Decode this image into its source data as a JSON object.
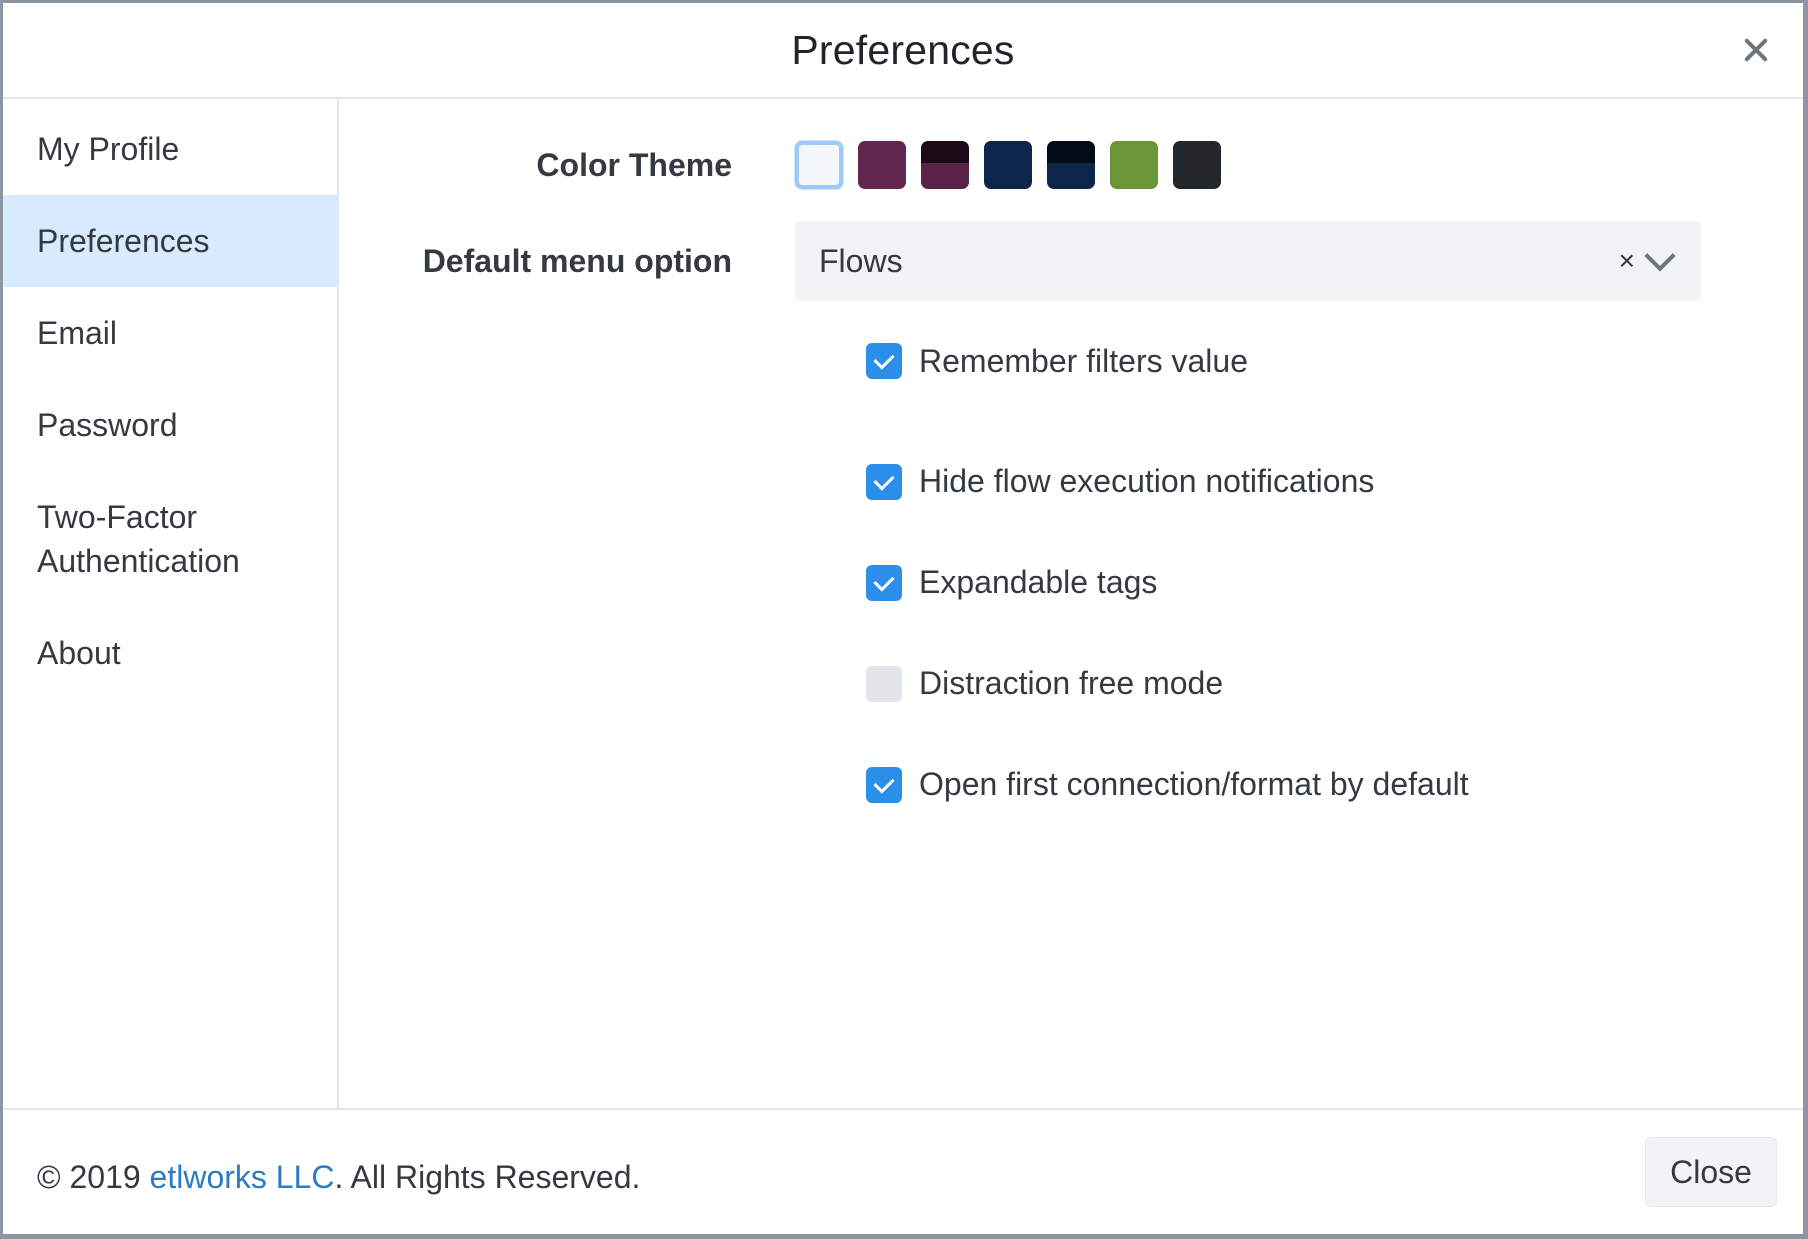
{
  "dialog": {
    "title": "Preferences",
    "close_icon": "close-icon"
  },
  "sidebar": {
    "items": [
      {
        "label": "My Profile",
        "active": false
      },
      {
        "label": "Preferences",
        "active": true
      },
      {
        "label": "Email",
        "active": false
      },
      {
        "label": "Password",
        "active": false
      },
      {
        "label_line1": "Two-Factor",
        "label_line2": "Authentication",
        "active": false
      },
      {
        "label": "About",
        "active": false
      }
    ]
  },
  "form": {
    "color_theme_label": "Color Theme",
    "themes": [
      {
        "top": "#f4f8fd",
        "bottom": "#f4f8fd",
        "selected": true
      },
      {
        "top": "#62264f",
        "bottom": "#62264f",
        "selected": false
      },
      {
        "top": "#1d0a16",
        "bottom": "#5b2249",
        "selected": false
      },
      {
        "top": "#0c2548",
        "bottom": "#0c2548",
        "selected": false
      },
      {
        "top": "#020a17",
        "bottom": "#0c2548",
        "selected": false
      },
      {
        "top": "#6a9538",
        "bottom": "#6a9538",
        "selected": false
      },
      {
        "top": "#25282b",
        "bottom": "#25282b",
        "selected": false
      }
    ],
    "default_menu_label": "Default menu option",
    "default_menu_value": "Flows",
    "clear_symbol": "×",
    "options": [
      {
        "label": "Remember filters value",
        "checked": true
      },
      {
        "label": "Hide flow execution notifications",
        "checked": true
      },
      {
        "label": "Expandable tags",
        "checked": true
      },
      {
        "label": "Distraction free mode",
        "checked": false
      },
      {
        "label": "Open first connection/format by default",
        "checked": true
      }
    ]
  },
  "footer": {
    "copyright_prefix": "© 2019 ",
    "company_link": "etlworks LLC",
    "copyright_suffix": ". All Rights Reserved.",
    "close_button": "Close"
  },
  "colors": {
    "accent": "#2b8ee8",
    "active_nav": "#d8eafd",
    "link": "#2c7bc7"
  }
}
